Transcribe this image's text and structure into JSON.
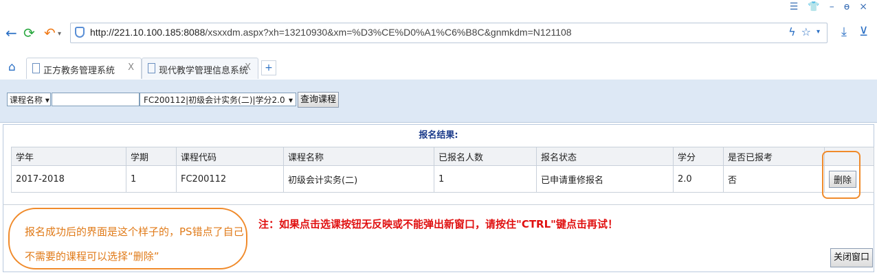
{
  "window_controls": {
    "menu_icon": "hamburger-icon",
    "skin_icon": "shirt-icon",
    "minimize": "–",
    "restore": "ƌ",
    "close": "×"
  },
  "nav": {
    "back_icon": "back-arrow-icon",
    "refresh_icon": "refresh-icon",
    "undo_icon": "undo-icon",
    "url_host": "http://221.10.100.185:8088",
    "url_path": "/xsxxdm.aspx?xh=13210930&xm=%D3%CE%D0%A1%C6%B8C&gnmkdm=N121108",
    "star_icon": "star-icon",
    "download_icon": "download-icon"
  },
  "tabs": [
    {
      "label": "正方教务管理系统",
      "close": "X"
    },
    {
      "label": "现代教学管理信息系统",
      "close": "X"
    }
  ],
  "toolbar": {
    "field_select": "课程名称",
    "search_value": "",
    "course_select": "FC200112|初级会计实务(二)|学分2.0",
    "query_button": "查询课程"
  },
  "results": {
    "title": "报名结果:",
    "headers": [
      "学年",
      "学期",
      "课程代码",
      "课程名称",
      "已报名人数",
      "报名状态",
      "学分",
      "是否已报考",
      ""
    ],
    "rows": [
      {
        "year": "2017-2018",
        "term": "1",
        "code": "FC200112",
        "name": "初级会计实务(二)",
        "enrolled": "1",
        "status": "已申请重修报名",
        "credit": "2.0",
        "registered": "否",
        "action": "删除"
      }
    ]
  },
  "annotations": {
    "callout_line1": "报名成功后的界面是这个样子的，PS错点了自己",
    "callout_line2": "不需要的课程可以选择“删除”",
    "note": "注：如果点击选课按钮无反映或不能弹出新窗口，请按住\"CTRL\"键点击再试！"
  },
  "footer": {
    "close_button": "关闭窗口"
  },
  "colors": {
    "accent": "#2a6fc4",
    "highlight": "#f08a2a",
    "warning": "#e01010"
  }
}
